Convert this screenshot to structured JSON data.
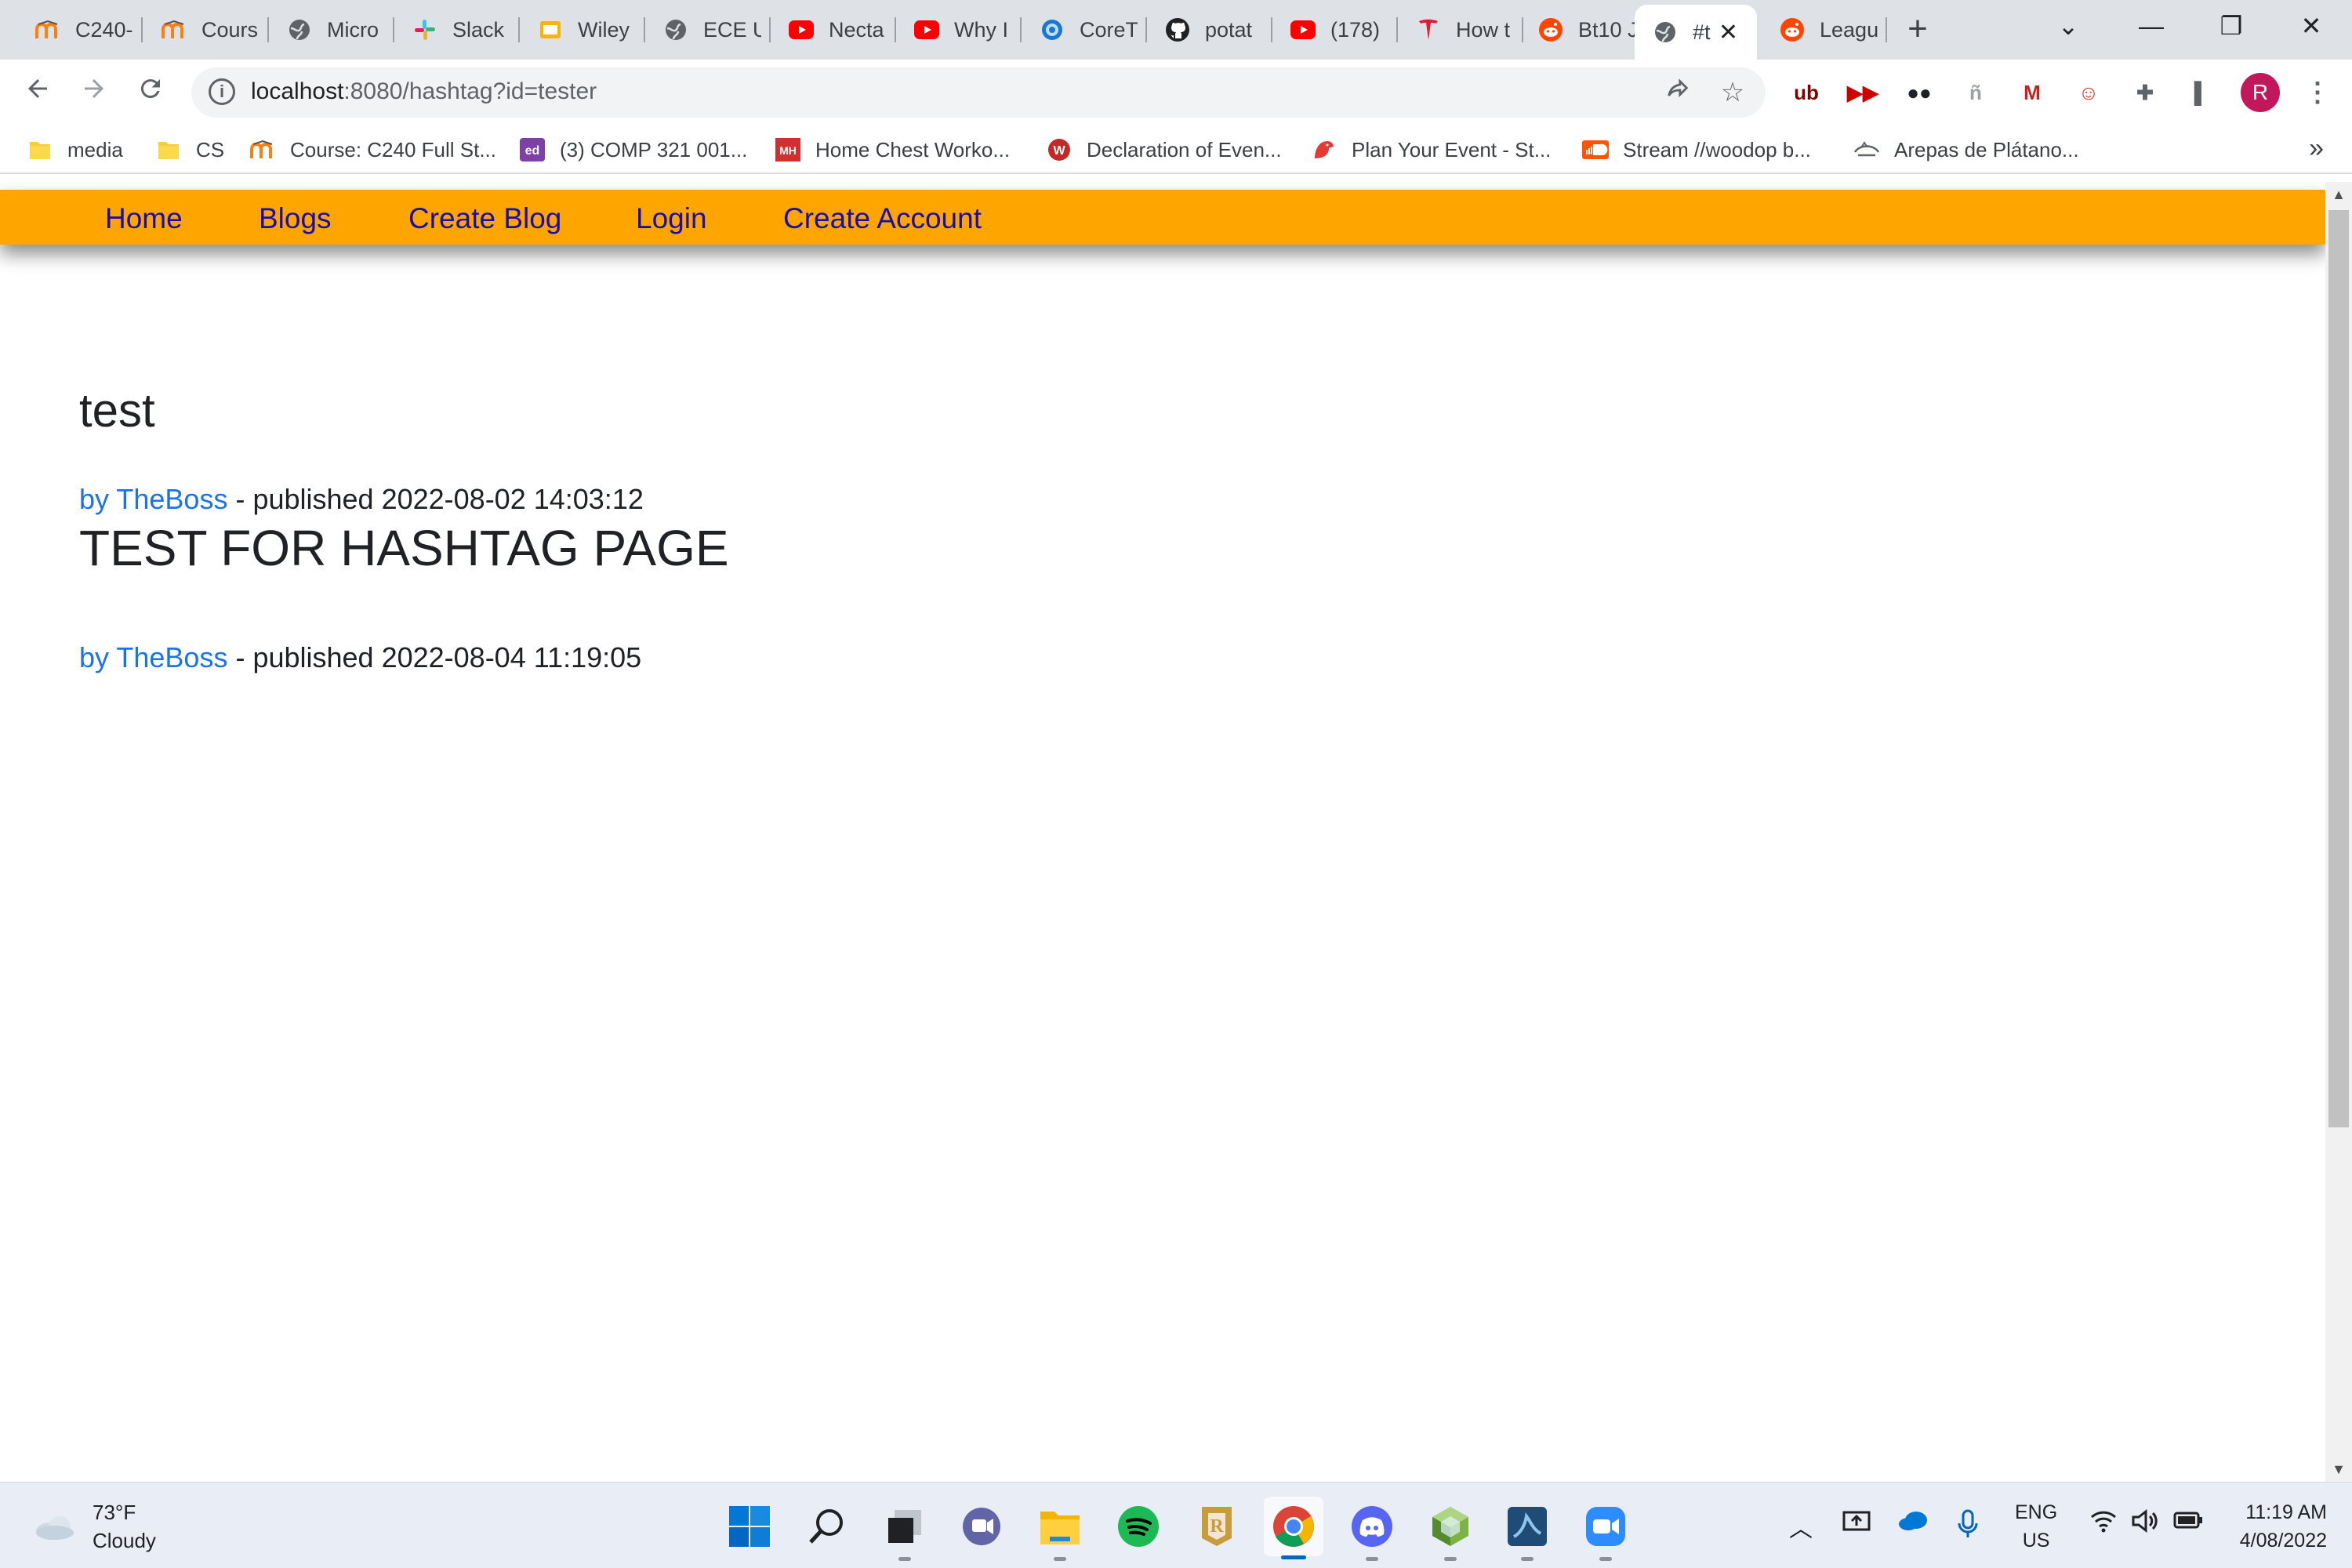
{
  "browser": {
    "tabs": [
      {
        "label": "C240-",
        "icon": "moodle-icon"
      },
      {
        "label": "Cours",
        "icon": "moodle-icon"
      },
      {
        "label": "Micro",
        "icon": "globe-icon"
      },
      {
        "label": "Slack",
        "icon": "slack-icon"
      },
      {
        "label": "Wiley",
        "icon": "wiley-icon"
      },
      {
        "label": "ECE U",
        "icon": "globe-icon"
      },
      {
        "label": "Necta",
        "icon": "youtube-icon"
      },
      {
        "label": "Why I",
        "icon": "youtube-icon"
      },
      {
        "label": "CoreT",
        "icon": "coretemp-icon"
      },
      {
        "label": "potat",
        "icon": "github-icon"
      },
      {
        "label": "(178)",
        "icon": "youtube-icon"
      },
      {
        "label": "How t",
        "icon": "tesla-icon"
      },
      {
        "label": "Bt10 J",
        "icon": "reddit-icon"
      },
      {
        "label": "#t",
        "icon": "globe-icon",
        "active": true
      },
      {
        "label": "Leagu",
        "icon": "reddit-icon"
      }
    ],
    "new_tab": "+",
    "tab_close": "✕",
    "window_controls": {
      "tab_search": "⌄",
      "minimize": "—",
      "restore": "❐",
      "close": "✕"
    },
    "url_host": "localhost",
    "url_rest": ":8080/hashtag?id=tester",
    "profile_initial": "R",
    "extensions": [
      {
        "name": "ublock-icon",
        "glyph": "ub",
        "color": "#800000"
      },
      {
        "name": "youtube-ext-icon",
        "glyph": "▶▶",
        "color": "#cc0000"
      },
      {
        "name": "ext-dark-icon",
        "glyph": "●●",
        "color": "#202124"
      },
      {
        "name": "ext-gray-icon",
        "glyph": "ñ",
        "color": "#9aa0a6"
      },
      {
        "name": "gmail-ext-icon",
        "glyph": "M",
        "color": "#c5221f"
      },
      {
        "name": "cat-ext-icon",
        "glyph": "☺",
        "color": "#d93025"
      },
      {
        "name": "puzzle-icon",
        "glyph": "✚",
        "color": "#5f6368"
      },
      {
        "name": "sidepanel-icon",
        "glyph": "▌",
        "color": "#5f6368"
      }
    ],
    "bookmarks": [
      {
        "label": "media",
        "icon": "folder-icon"
      },
      {
        "label": "CS",
        "icon": "folder-icon"
      },
      {
        "label": "Course: C240 Full St...",
        "icon": "moodle-icon"
      },
      {
        "label": "(3) COMP 321 001...",
        "icon": "ed-icon"
      },
      {
        "label": "Home Chest Worko...",
        "icon": "mh-icon"
      },
      {
        "label": "Declaration of Even...",
        "icon": "w-icon"
      },
      {
        "label": "Plan Your Event - St...",
        "icon": "bird-icon"
      },
      {
        "label": "Stream //woodop b...",
        "icon": "soundcloud-icon"
      },
      {
        "label": "Arepas de Plátano...",
        "icon": "arepa-icon"
      }
    ],
    "bookmarks_more": "»"
  },
  "site": {
    "nav": [
      "Home",
      "Blogs",
      "Create Blog",
      "Login",
      "Create Account"
    ],
    "hashtag_title": "test",
    "posts": [
      {
        "author": "by TheBoss",
        "published": " - published 2022-08-02 14:03:12",
        "title": "TEST FOR HASHTAG PAGE"
      },
      {
        "author": "by TheBoss",
        "published": " - published 2022-08-04 11:19:05",
        "title": ""
      }
    ]
  },
  "taskbar": {
    "weather_temp": "73°F",
    "weather_desc": "Cloudy",
    "apps": [
      "windows-start-icon",
      "search-icon",
      "task-view-icon",
      "teams-chat-icon",
      "file-explorer-icon",
      "spotify-icon",
      "riot-icon",
      "chrome-icon",
      "discord-icon",
      "hexagon-app-icon",
      "mysql-workbench-icon",
      "zoom-icon"
    ],
    "lang_1": "ENG",
    "lang_2": "US",
    "time": "11:19 AM",
    "date": "4/08/2022"
  }
}
